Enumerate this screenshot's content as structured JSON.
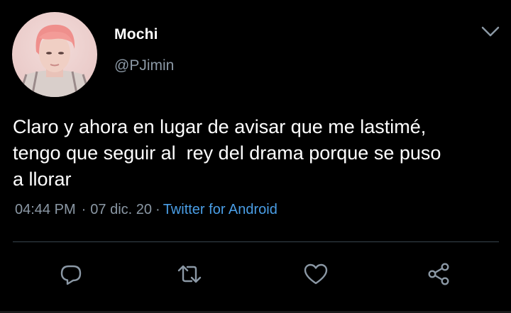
{
  "tweet": {
    "display_name": "Mochi",
    "handle": "@PJimin",
    "text": "Claro y ahora en lugar de avisar que me lastimé,\ntengo que seguir al  rey del drama porque se puso\na llorar",
    "time": "04:44 PM",
    "date": "07 dic. 20",
    "separator": "·",
    "source": "Twitter for Android"
  },
  "icons": {
    "menu": "chevron-down-icon",
    "reply": "reply-icon",
    "retweet": "retweet-icon",
    "like": "heart-icon",
    "share": "share-icon"
  },
  "colors": {
    "background": "#000000",
    "secondary_text": "#8b98a5",
    "link": "#4a9ee6",
    "divider": "#38444d"
  }
}
